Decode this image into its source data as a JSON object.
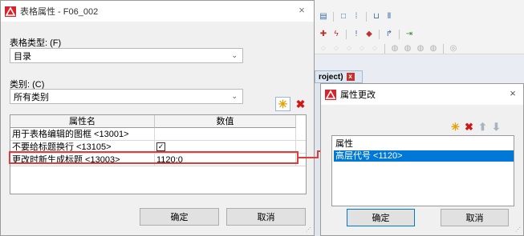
{
  "main_dialog": {
    "title": "表格属性 - F06_002",
    "table_type_label": "表格类型: (F)",
    "table_type_value": "目录",
    "category_label": "类别: (C)",
    "category_value": "所有类别",
    "grid": {
      "headers": [
        "属性名",
        "数值"
      ],
      "rows": [
        {
          "name": "用于表格编辑的图框 <13001>",
          "value": ""
        },
        {
          "name": "不要给标题换行 <13105>",
          "value": "",
          "checkbox": true,
          "checked": true
        },
        {
          "name": "更改时新生成标题 <13003>",
          "value": "1120;0"
        }
      ]
    },
    "ok_label": "确定",
    "cancel_label": "取消"
  },
  "background": {
    "tab_label": "roject)",
    "tab_close": "x"
  },
  "sub_dialog": {
    "title": "属性更改",
    "list": {
      "header": "属性",
      "items": [
        "高层代号 <1120>"
      ],
      "selected_index": 0
    },
    "ok_label": "确定",
    "cancel_label": "取消"
  },
  "colors": {
    "highlight": "#e03c3c",
    "selection": "#0078d7",
    "new_icon": "#e8a000",
    "delete_icon": "#d01818",
    "arrow_disabled": "#a8b4c0"
  },
  "icons": {
    "close": "×",
    "chevron": "⌄",
    "new": "✳",
    "delete": "✖",
    "up": "⬆",
    "down": "⬇",
    "check": "✓"
  }
}
